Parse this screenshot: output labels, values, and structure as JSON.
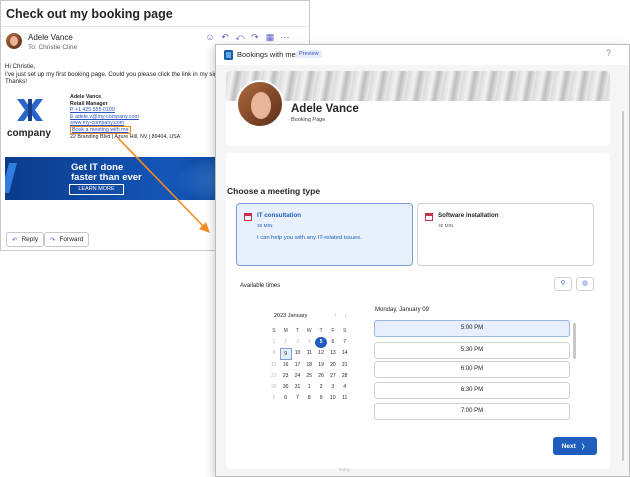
{
  "email": {
    "subject": "Check out my booking page",
    "sender": "Adele Vance",
    "to": "To: Christie Cline",
    "toolbar_icons": [
      "emoji-icon",
      "reply-icon",
      "reply-all-icon",
      "forward-icon",
      "grid-icon",
      "more-icon"
    ],
    "body_lines": [
      "Hi Christie,",
      "I've just set up my first booking page. Could you please click the link in my signature",
      "Thanks!"
    ],
    "logo_text": "company",
    "signature": {
      "name": "Adele Vance",
      "title": "Retail Manager",
      "phone": "P +1 425 555 0109",
      "email": "E adele.v@my-company.com",
      "website": "www.my-company.com",
      "booking_link": "Book a meeting with me",
      "address": "22 Branding Blvd | Azure Hill, NV | 89404, USA"
    },
    "banner": {
      "headline_1": "Get IT done",
      "headline_2": "faster than ever",
      "cta": "LEARN MORE"
    },
    "reply_label": "Reply",
    "forward_label": "Forward"
  },
  "bookings": {
    "window_title": "Bookings with me",
    "preview_badge": "Preview",
    "help": "?",
    "host_name": "Adele Vance",
    "page_label": "Booking Page",
    "choose_heading": "Choose a meeting type",
    "services": [
      {
        "name": "IT consultation",
        "duration": "30 MIN",
        "description": "I can help you with any IT-related issues."
      },
      {
        "name": "Software installation",
        "duration": "30 MIN",
        "description": ""
      }
    ],
    "available_times_label": "Available times",
    "calendar": {
      "month_label": "2023 January",
      "weekdays": [
        "S",
        "M",
        "T",
        "W",
        "T",
        "F",
        "S"
      ],
      "weeks": [
        [
          "1",
          "2",
          "3",
          "4",
          "5",
          "6",
          "7"
        ],
        [
          "8",
          "9",
          "10",
          "11",
          "12",
          "13",
          "14"
        ],
        [
          "15",
          "16",
          "17",
          "18",
          "19",
          "20",
          "21"
        ],
        [
          "22",
          "23",
          "24",
          "25",
          "26",
          "27",
          "28"
        ],
        [
          "29",
          "30",
          "31",
          "1",
          "2",
          "3",
          "4"
        ],
        [
          "5",
          "6",
          "7",
          "8",
          "9",
          "10",
          "11"
        ]
      ],
      "today_label": "Today"
    },
    "selected_day": "Monday, January 09",
    "time_slots": [
      "5:00 PM",
      "5:30 PM",
      "6:00 PM",
      "6:30 PM",
      "7:00 PM"
    ],
    "next_label": "Next"
  }
}
